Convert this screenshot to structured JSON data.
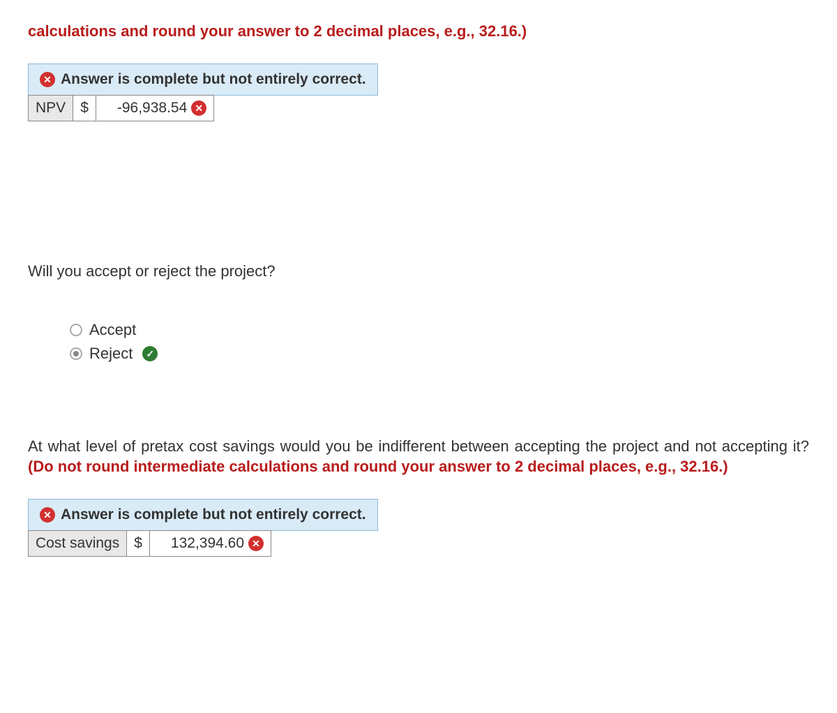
{
  "topInstruction": "calculations and round your answer to 2 decimal places, e.g., 32.16.)",
  "feedback1": {
    "message": "Answer is complete but not entirely correct."
  },
  "npvRow": {
    "label": "NPV",
    "currency": "$",
    "value": "-96,938.54"
  },
  "question1": "Will you accept or reject the project?",
  "options": {
    "accept": "Accept",
    "reject": "Reject"
  },
  "paragraph": {
    "blackText": "At what level of pretax cost savings would you be indifferent between accepting the project and not accepting it? ",
    "redText": "(Do not round intermediate calculations and round your answer to 2 decimal places, e.g., 32.16.)"
  },
  "feedback2": {
    "message": "Answer is complete but not entirely correct."
  },
  "costRow": {
    "label": "Cost savings",
    "currency": "$",
    "value": "132,394.60"
  }
}
